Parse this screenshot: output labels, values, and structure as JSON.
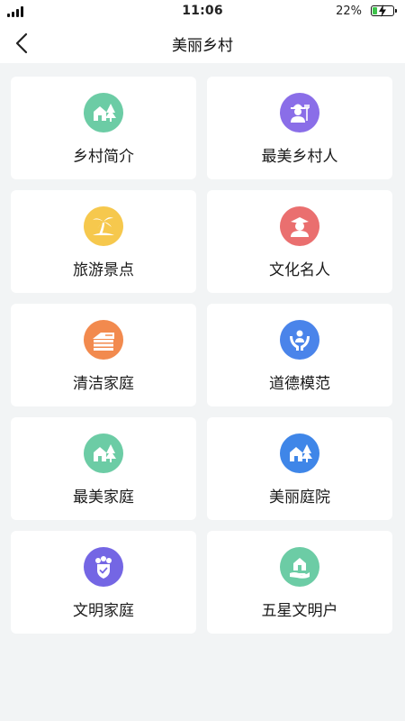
{
  "status": {
    "time": "11:06",
    "battery": "22%",
    "battery_level": 0.22
  },
  "nav": {
    "title": "美丽乡村",
    "back_icon": "chevron-left-icon"
  },
  "tiles": [
    {
      "label": "乡村简介",
      "icon": "house-tree-icon",
      "color": "#6ccca5"
    },
    {
      "label": "最美乡村人",
      "icon": "farmer-icon",
      "color": "#8a6ee8"
    },
    {
      "label": "旅游景点",
      "icon": "palm-island-icon",
      "color": "#f6c84d"
    },
    {
      "label": "文化名人",
      "icon": "scholar-icon",
      "color": "#ea6f6f"
    },
    {
      "label": "清洁家庭",
      "icon": "clean-house-icon",
      "color": "#f28a4e"
    },
    {
      "label": "道德模范",
      "icon": "hands-person-icon",
      "color": "#4a84ea"
    },
    {
      "label": "最美家庭",
      "icon": "house-tree-icon",
      "color": "#6ccca5"
    },
    {
      "label": "美丽庭院",
      "icon": "house-tree-icon",
      "color": "#3f86e8"
    },
    {
      "label": "文明家庭",
      "icon": "family-shield-icon",
      "color": "#7466e4"
    },
    {
      "label": "五星文明户",
      "icon": "hand-home-icon",
      "color": "#6ccca5"
    }
  ]
}
